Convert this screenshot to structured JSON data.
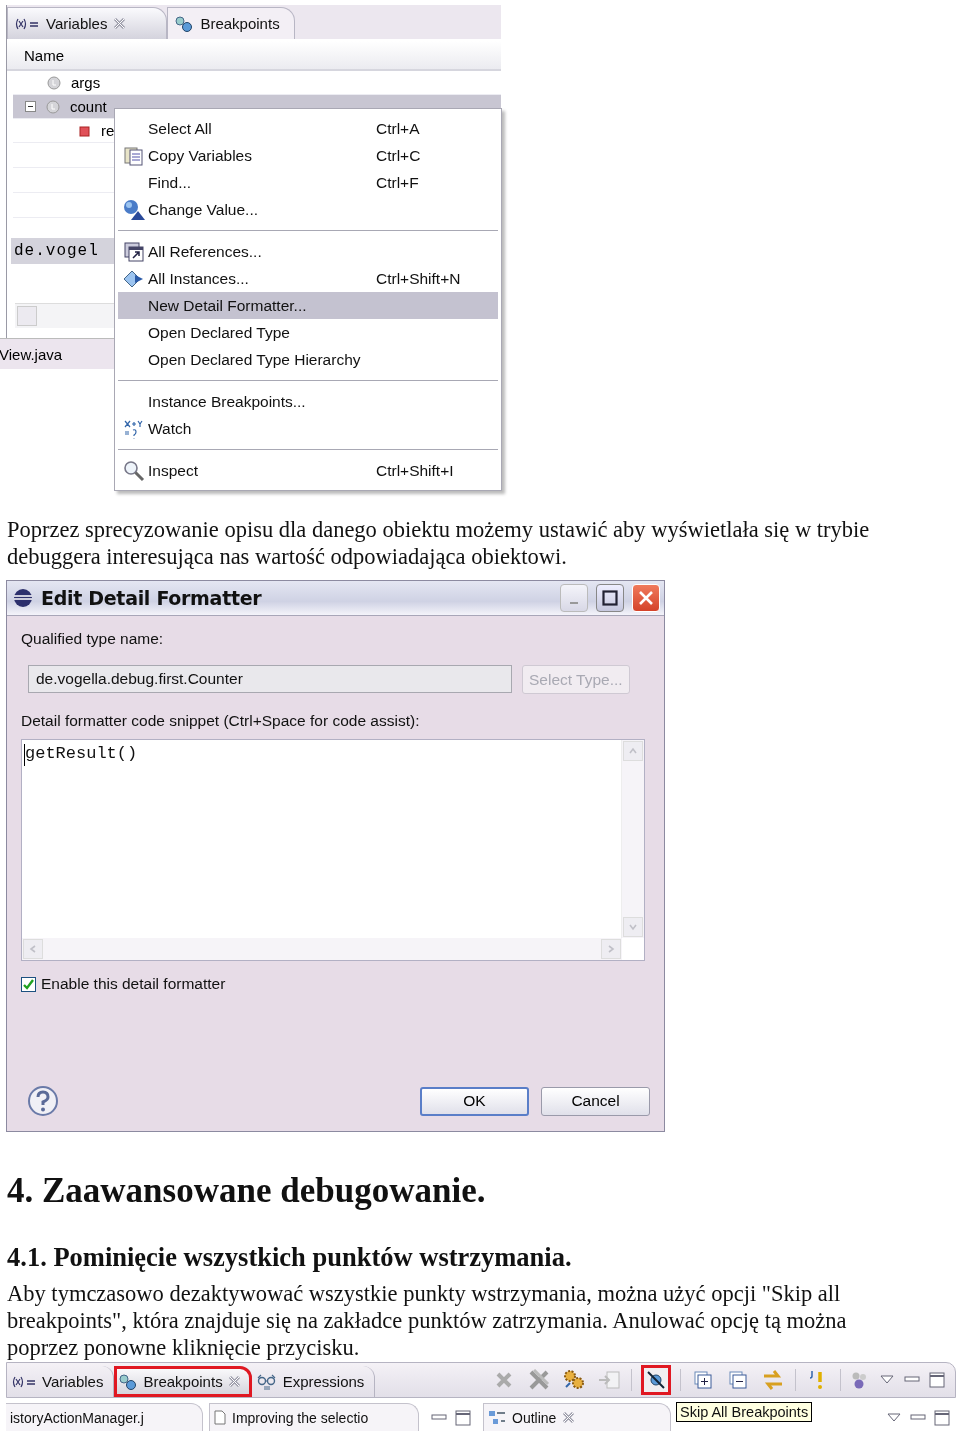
{
  "variables_view": {
    "tabs": [
      {
        "label": "Variables",
        "selected": true,
        "closable": true
      },
      {
        "label": "Breakpoints",
        "selected": false,
        "closable": false
      }
    ],
    "column": "Name",
    "rows": [
      {
        "name": "args",
        "kind": "local",
        "selected": false
      },
      {
        "name": "count",
        "kind": "local",
        "selected": true,
        "expanded": true,
        "children": [
          {
            "name": "re",
            "kind": "field",
            "selected": false
          }
        ]
      }
    ],
    "detail": "de.vogel",
    "editor_tab": "View.java"
  },
  "context_menu": {
    "items": [
      {
        "kind": "item",
        "label": "Select All",
        "shortcut": "Ctrl+A",
        "selected": false
      },
      {
        "kind": "item",
        "label": "Copy Variables",
        "shortcut": "Ctrl+C",
        "selected": false
      },
      {
        "kind": "item",
        "label": "Find...",
        "shortcut": "Ctrl+F",
        "selected": false
      },
      {
        "kind": "item",
        "label": "Change Value...",
        "selected": false
      },
      {
        "kind": "separator"
      },
      {
        "kind": "item",
        "label": "All References...",
        "selected": false
      },
      {
        "kind": "item",
        "label": "All Instances...",
        "shortcut": "Ctrl+Shift+N",
        "selected": false
      },
      {
        "kind": "item",
        "label": "New Detail Formatter...",
        "selected": true
      },
      {
        "kind": "item",
        "label": "Open Declared Type",
        "selected": false
      },
      {
        "kind": "item",
        "label": "Open Declared Type Hierarchy",
        "selected": false
      },
      {
        "kind": "separator"
      },
      {
        "kind": "item",
        "label": "Instance Breakpoints...",
        "selected": false
      },
      {
        "kind": "item",
        "label": "Watch",
        "selected": false
      },
      {
        "kind": "separator"
      },
      {
        "kind": "item",
        "label": "Inspect",
        "shortcut": "Ctrl+Shift+I",
        "selected": false
      }
    ]
  },
  "caption": "Poprzez sprecyzowanie opisu dla danego obiektu możemy ustawić aby wyświetlała się w trybie debuggera interesująca nas wartość odpowiadająca obiektowi.",
  "dialog": {
    "title": "Edit Detail Formatter",
    "type_label": "Qualified type name:",
    "type_value": "de.vogella.debug.first.Counter",
    "select_button": {
      "label": "Select Type...",
      "disabled": true
    },
    "snippet_label": "Detail formatter code snippet (Ctrl+Space for code assist):",
    "snippet": "getResult()",
    "enable": {
      "label": "Enable this detail formatter",
      "checked": true
    },
    "buttons": [
      {
        "label": "OK",
        "default": true
      },
      {
        "label": "Cancel",
        "default": false
      }
    ]
  },
  "heading": "4. Zaawansowane debugowanie.",
  "subheading": "4.1. Pominięcie wszystkich punktów wstrzymania.",
  "body": "Aby tymczasowo dezaktywować wszystkie punkty wstrzymania, można użyć opcji \"Skip all breakpoints\", która znajduje się na zakładce punktów zatrzymania. Anulować opcję tą można poprzez ponowne kliknięcie przycisku.",
  "breakpoints_view": {
    "tabs": [
      {
        "label": "Variables",
        "selected": false,
        "highlighted": false,
        "closable": false
      },
      {
        "label": "Breakpoints",
        "selected": true,
        "highlighted": true,
        "closable": true
      },
      {
        "label": "Expressions",
        "selected": false,
        "highlighted": false,
        "closable": false
      }
    ],
    "tools": [
      {
        "kind": "remove",
        "highlighted": false
      },
      {
        "kind": "remove-all",
        "highlighted": false
      },
      {
        "kind": "gears",
        "highlighted": false
      },
      {
        "kind": "import",
        "highlighted": false
      },
      {
        "kind": "skip",
        "highlighted": true
      },
      {
        "kind": "expand",
        "highlighted": false
      },
      {
        "kind": "collapse",
        "highlighted": false
      },
      {
        "kind": "link",
        "highlighted": false
      },
      {
        "kind": "exception",
        "highlighted": false
      }
    ],
    "tooltip": "Skip All Breakpoints",
    "editor_tabs": [
      {
        "label": "istoryActionManager.j"
      },
      {
        "label": "Improving the selectio"
      }
    ],
    "outline_tab": "Outline"
  }
}
